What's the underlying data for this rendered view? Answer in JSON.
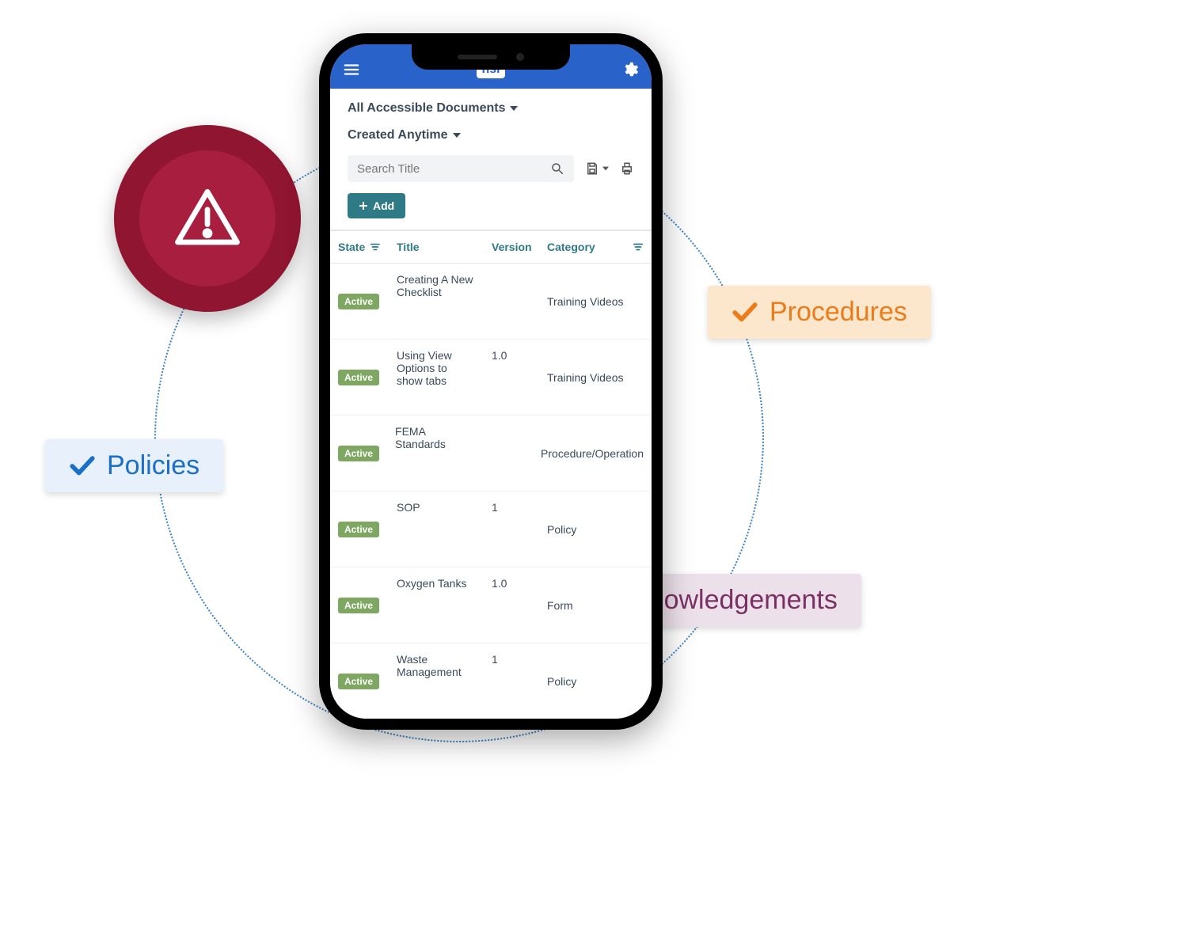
{
  "colors": {
    "accent": "#2962c9",
    "add": "#2f7a87",
    "badge": "#7ea862",
    "policies": "#1a6fc9",
    "procedures": "#ec7c1a",
    "ack": "#7b3063",
    "warn": "#a71e3e"
  },
  "brand": {
    "logo_text": "hsi"
  },
  "pills": {
    "policies": "Policies",
    "procedures": "Procedures",
    "ack": "Acknowledgements"
  },
  "filters": {
    "scope": "All Accessible Documents",
    "created": "Created Anytime",
    "search_placeholder": "Search Title"
  },
  "buttons": {
    "add": "Add"
  },
  "table": {
    "headers": {
      "state": "State",
      "title": "Title",
      "version": "Version",
      "category": "Category"
    },
    "rows": [
      {
        "state": "Active",
        "title": "Creating A New Checklist",
        "version": "",
        "category": "Training Videos"
      },
      {
        "state": "Active",
        "title": "Using View Options to show tabs",
        "version": "1.0",
        "category": "Training Videos"
      },
      {
        "state": "Active",
        "title": "FEMA Standards",
        "version": "",
        "category": "Procedure/Operation"
      },
      {
        "state": "Active",
        "title": "SOP",
        "version": "1",
        "category": "Policy"
      },
      {
        "state": "Active",
        "title": "Oxygen Tanks",
        "version": "1.0",
        "category": "Form"
      },
      {
        "state": "Active",
        "title": "Waste Management",
        "version": "1",
        "category": "Policy"
      }
    ]
  }
}
